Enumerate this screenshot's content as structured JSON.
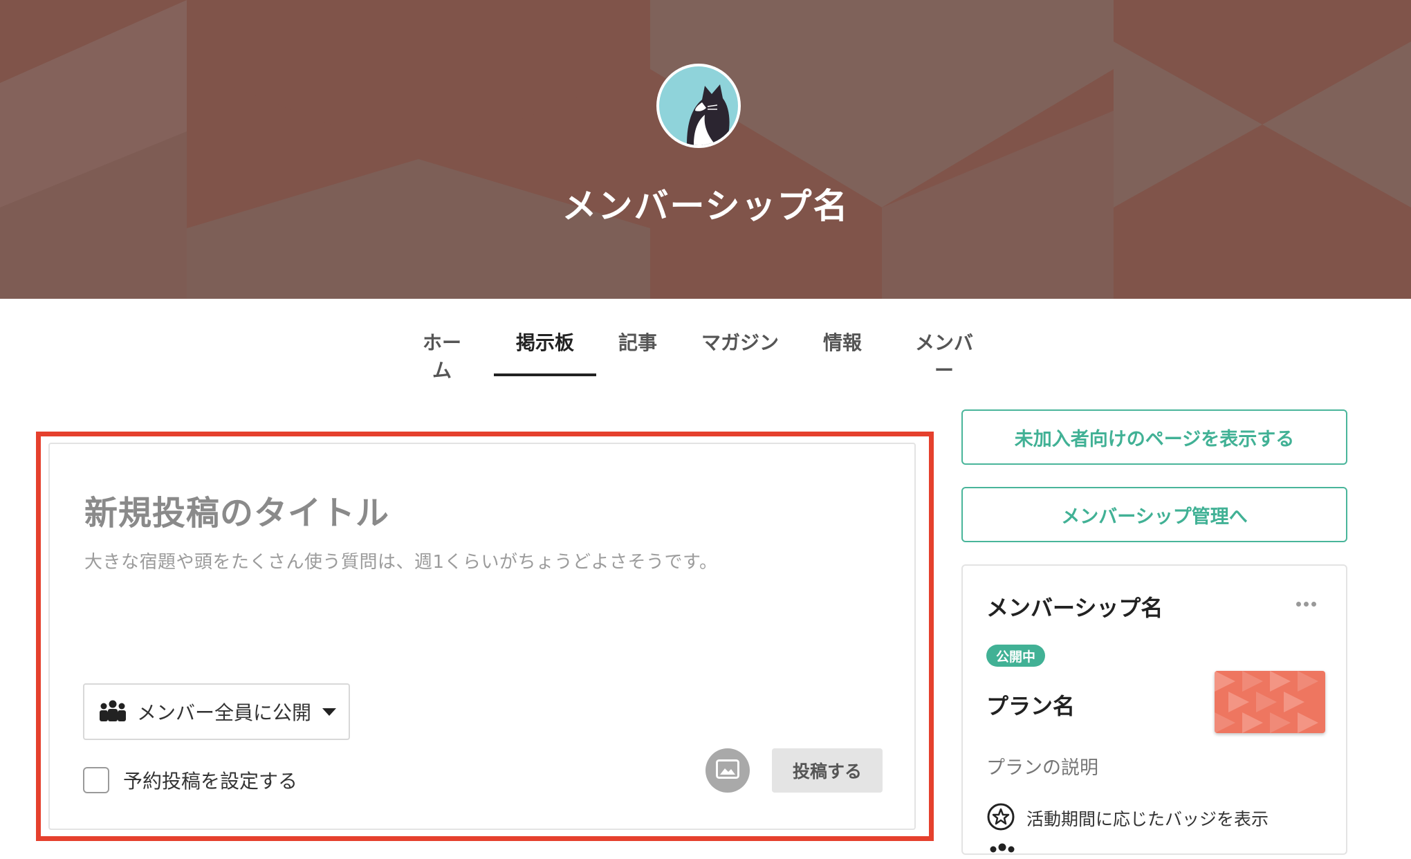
{
  "header": {
    "title": "メンバーシップ名",
    "banner_color": "#80544a",
    "avatar_icon": "cat-avatar-icon"
  },
  "tabs": [
    {
      "label": "ホーム",
      "active": false
    },
    {
      "label": "掲示板",
      "active": true
    },
    {
      "label": "記事",
      "active": false
    },
    {
      "label": "マガジン",
      "active": false
    },
    {
      "label": "情報",
      "active": false
    },
    {
      "label": "メンバー",
      "active": false
    }
  ],
  "post": {
    "title_placeholder": "新規投稿のタイトル",
    "body_placeholder": "大きな宿題や頭をたくさん使う質問は、週1くらいがちょうどよさそうです。",
    "visibility": "メンバー全員に公開",
    "schedule_label": "予約投稿を設定する",
    "submit_label": "投稿する",
    "highlight_color": "#e5402d"
  },
  "sidebar": {
    "guest_page_button": "未加入者向けのページを表示する",
    "manage_button": "メンバーシップ管理へ",
    "card": {
      "name": "メンバーシップ名",
      "status_badge": "公開中",
      "plan_name": "プラン名",
      "plan_description": "プランの説明",
      "feature": "活動期間に応じたバッジを表示"
    },
    "accent_color": "#41b195"
  }
}
